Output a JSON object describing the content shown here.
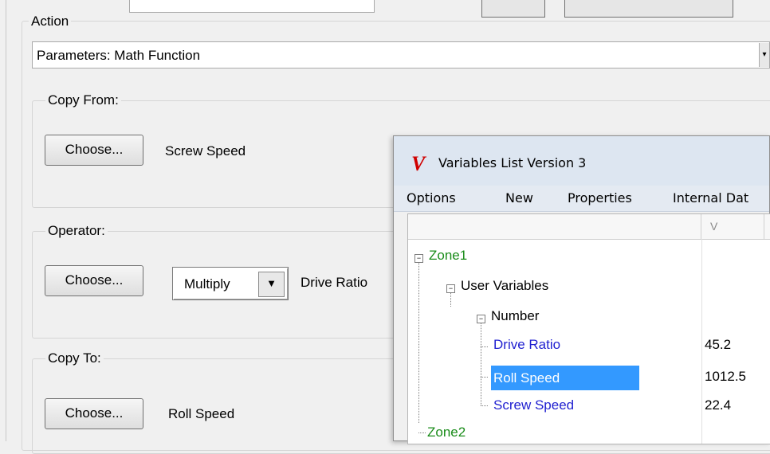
{
  "action": {
    "group_title": "Action",
    "selected": "Parameters: Math Function",
    "dropdown_arrow": "▾"
  },
  "copy_from": {
    "group_title": "Copy From:",
    "choose_label": "Choose...",
    "value": "Screw Speed"
  },
  "operator": {
    "group_title": "Operator:",
    "choose_label": "Choose...",
    "operation": "Multiply",
    "value": "Drive Ratio",
    "arrow": "▼"
  },
  "copy_to": {
    "group_title": "Copy To:",
    "choose_label": "Choose...",
    "value": "Roll Speed"
  },
  "variables_window": {
    "logo": "V",
    "title": "Variables List Version 3",
    "menu": [
      "Options",
      "New",
      "Properties",
      "Internal Dat"
    ],
    "column_header_value": "V",
    "tree": {
      "zone1": "Zone1",
      "user_variables": "User Variables",
      "number": "Number",
      "items": [
        {
          "name": "Drive Ratio",
          "value": "45.2"
        },
        {
          "name": "Roll Speed",
          "value": "1012.5"
        },
        {
          "name": "Screw Speed",
          "value": "22.4"
        }
      ],
      "zone2": "Zone2",
      "expander_symbol": "−"
    }
  },
  "colors": {
    "zone_text": "#1a8c1a",
    "variable_text": "#1f1fd0",
    "selection": "#3399ff",
    "logo": "#d00000"
  }
}
